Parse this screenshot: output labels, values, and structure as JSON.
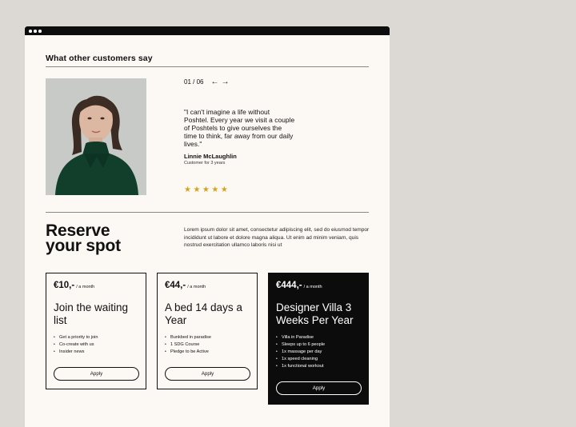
{
  "testimonials": {
    "section_title": "What other customers say",
    "pager": "01 / 06",
    "prev_arrow": "←",
    "next_arrow": "→",
    "quote": "\"I can't imagine a life without Poshtel. Every year we visit a couple of Poshtels to give ourselves the time to think, far away from our daily lives.\"",
    "author": "Linnie McLaughlin",
    "role": "Customer for 3 years",
    "stars": "★★★★★",
    "rating": 5
  },
  "reserve": {
    "heading_line1": "Reserve",
    "heading_line2": "your spot",
    "description": "Lorem ipsum dolor sit amet, consectetur adipiscing elit, sed do eiusmod tempor incididunt ut labore et dolore magna aliqua. Ut enim ad minim veniam, quis nostrud exercitation ullamco laboris nisi ut"
  },
  "plans": [
    {
      "price": "€10,-",
      "period": "/ a month",
      "title": "Join the waiting list",
      "features": [
        "Get a priority to join",
        "Co-create with us",
        "Insider news"
      ],
      "apply_label": "Apply"
    },
    {
      "price": "€44,-",
      "period": "/ a month",
      "title": "A bed 14 days a Year",
      "features": [
        "Bunkbed in paradise",
        "1 SDG Course",
        "Pledge to be Active"
      ],
      "apply_label": "Apply"
    },
    {
      "price": "€444,-",
      "period": "/ a month",
      "title": "Designer Villa 3 Weeks Per Year",
      "features": [
        "Villa in Paradise",
        "Sleeps up to 6 people",
        "1x massage per day",
        "1x speed cleaning",
        "1x functional workout"
      ],
      "apply_label": "Apply"
    }
  ],
  "colors": {
    "page_background": "#dcd8d3",
    "window_background": "#fcf9f4",
    "ink": "#111111",
    "star": "#d4a21f",
    "featured_card": "#0c0c0c"
  }
}
